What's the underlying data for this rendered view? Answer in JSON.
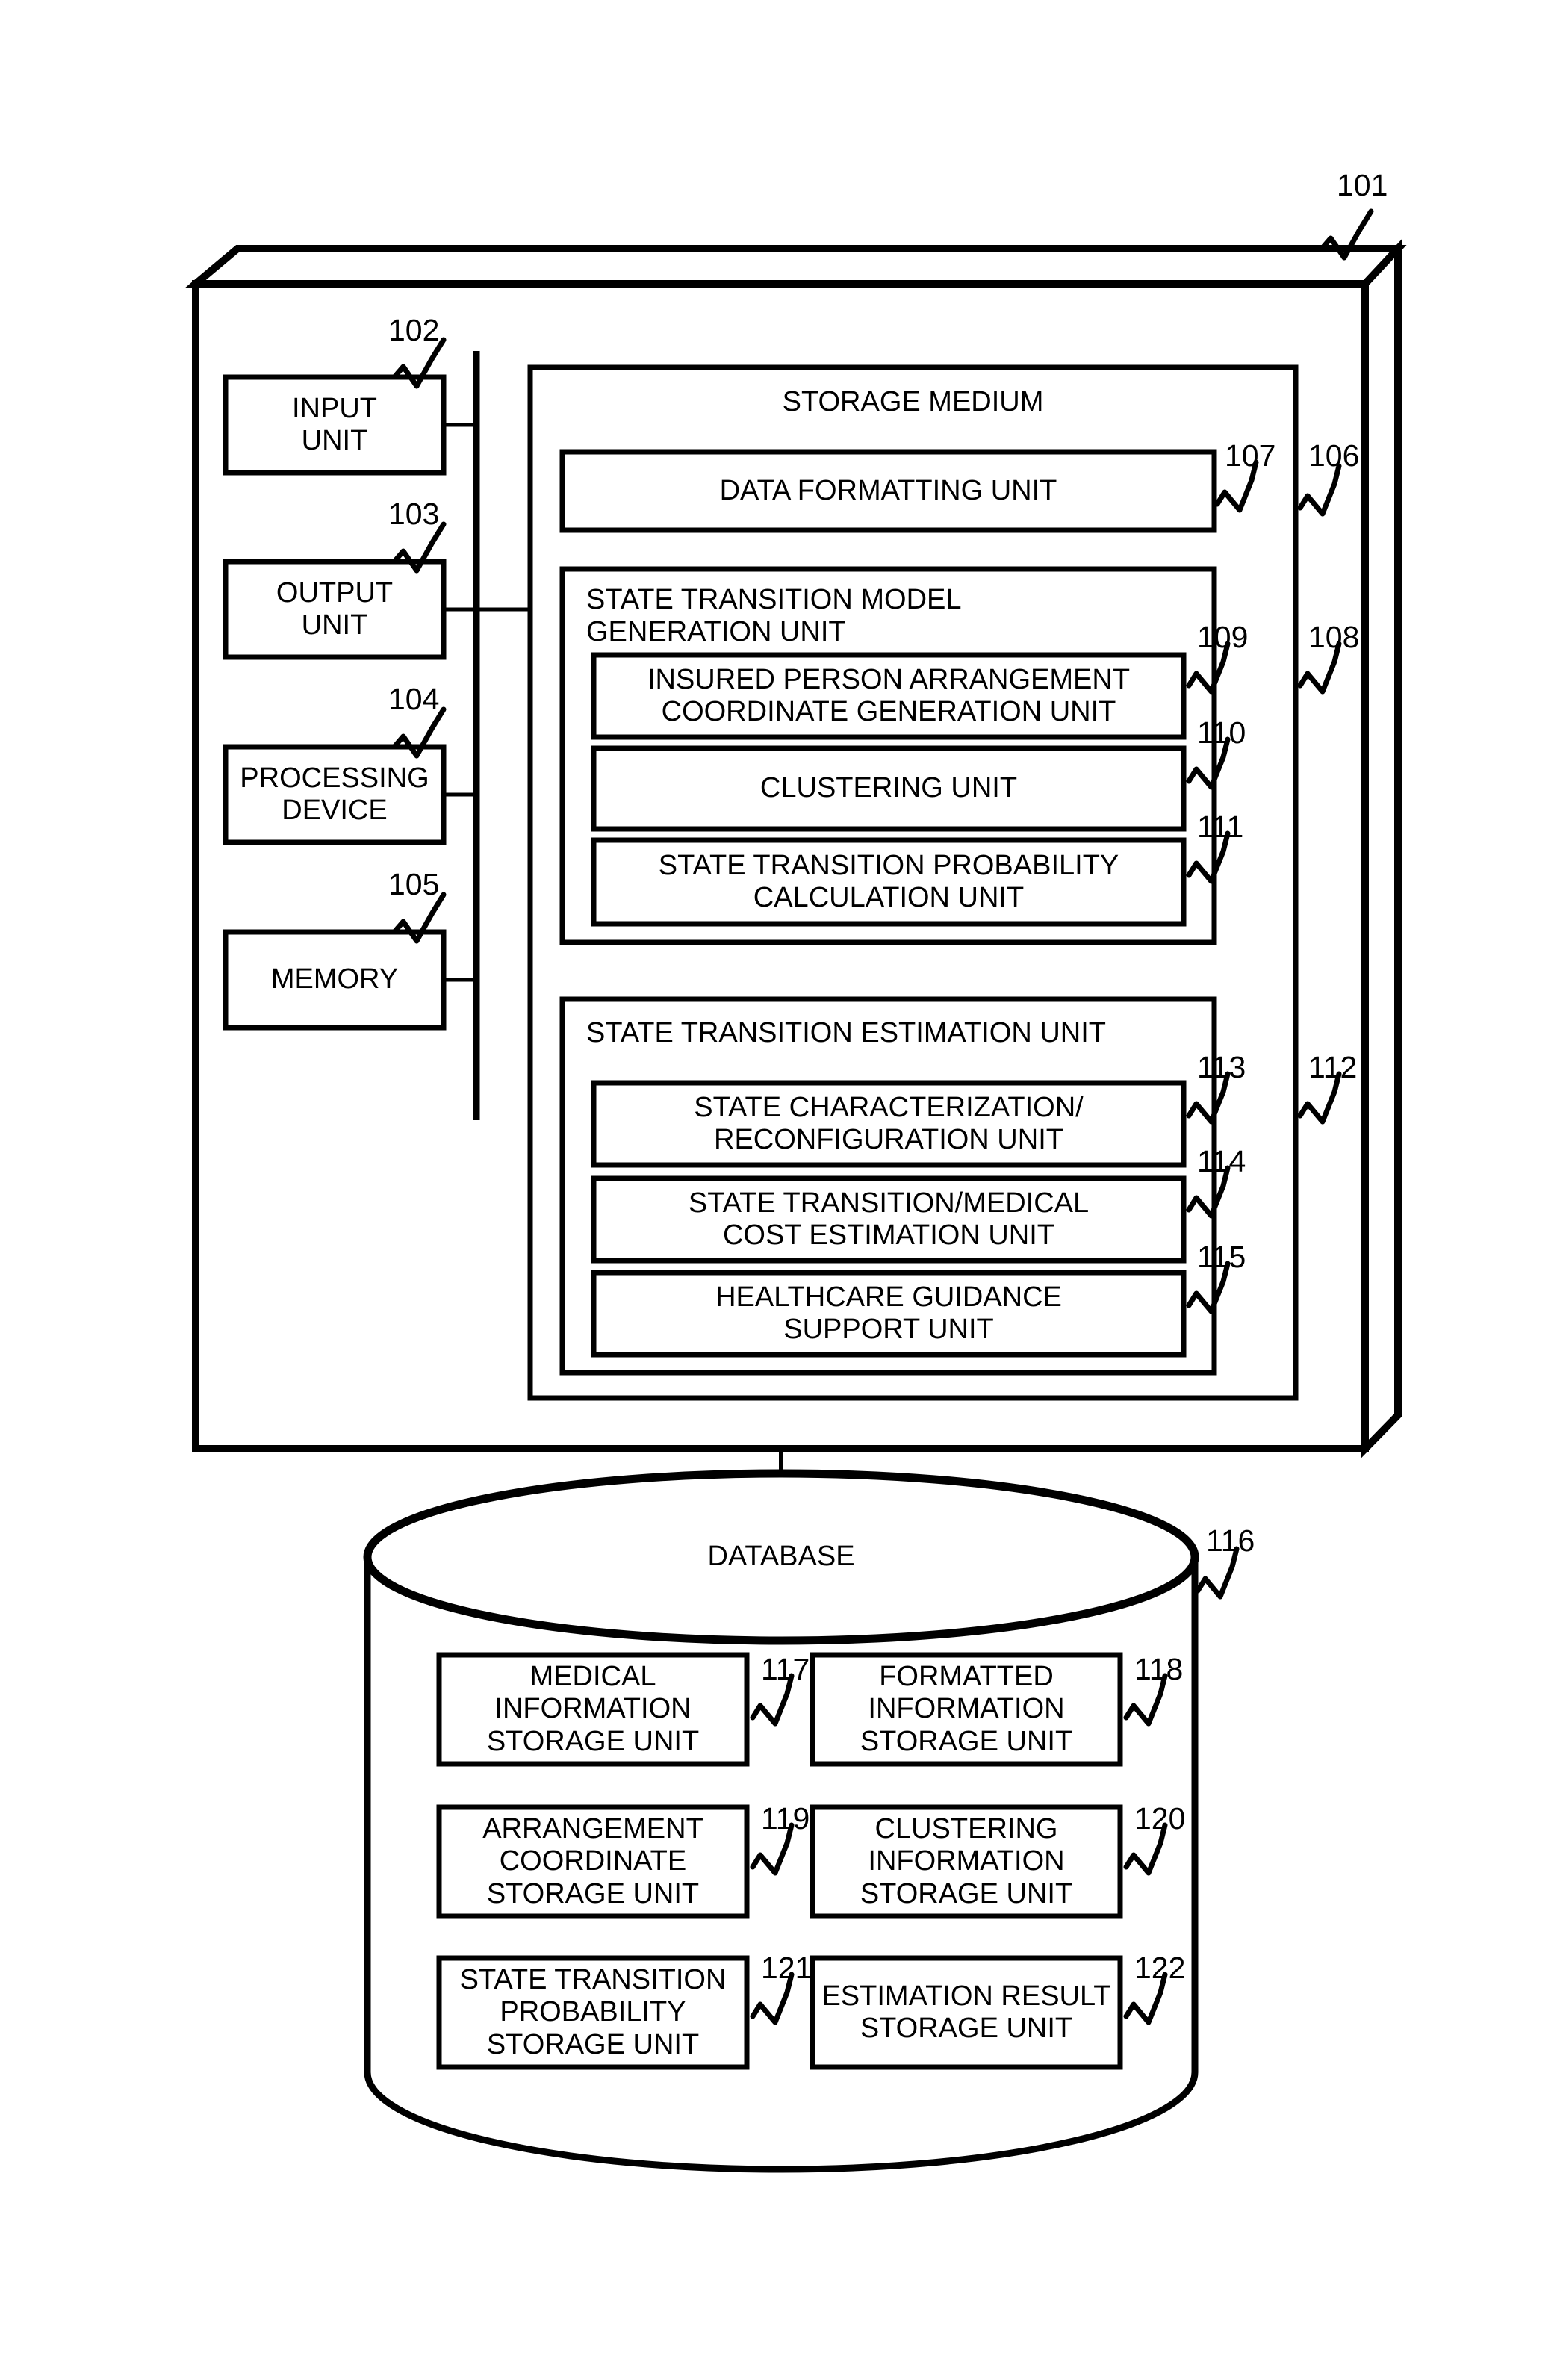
{
  "figure": {
    "type": "patent-block-diagram",
    "system_ref": "101",
    "device_boxes": [
      {
        "ref": "102",
        "label": "INPUT\nUNIT"
      },
      {
        "ref": "103",
        "label": "OUTPUT\nUNIT"
      },
      {
        "ref": "104",
        "label": "PROCESSING\nDEVICE"
      },
      {
        "ref": "105",
        "label": "MEMORY"
      }
    ],
    "storage_medium": {
      "ref": "106",
      "title": "STORAGE MEDIUM",
      "data_formatting_unit": {
        "ref": "107",
        "label": "DATA FORMATTING UNIT"
      },
      "model_generation_unit": {
        "ref": "108",
        "title": "STATE TRANSITION MODEL\nGENERATION UNIT",
        "children": [
          {
            "ref": "109",
            "label": "INSURED PERSON ARRANGEMENT\nCOORDINATE GENERATION UNIT"
          },
          {
            "ref": "110",
            "label": "CLUSTERING UNIT"
          },
          {
            "ref": "111",
            "label": "STATE TRANSITION PROBABILITY\nCALCULATION UNIT"
          }
        ]
      },
      "estimation_unit": {
        "ref": "112",
        "title": "STATE TRANSITION ESTIMATION UNIT",
        "children": [
          {
            "ref": "113",
            "label": "STATE CHARACTERIZATION/\nRECONFIGURATION UNIT"
          },
          {
            "ref": "114",
            "label": "STATE TRANSITION/MEDICAL\nCOST ESTIMATION UNIT"
          },
          {
            "ref": "115",
            "label": "HEALTHCARE GUIDANCE\nSUPPORT UNIT"
          }
        ]
      }
    },
    "database": {
      "ref": "116",
      "title": "DATABASE",
      "storage_units": [
        {
          "ref": "117",
          "label": "MEDICAL\nINFORMATION\nSTORAGE UNIT"
        },
        {
          "ref": "118",
          "label": "FORMATTED\nINFORMATION\nSTORAGE UNIT"
        },
        {
          "ref": "119",
          "label": "ARRANGEMENT\nCOORDINATE\nSTORAGE UNIT"
        },
        {
          "ref": "120",
          "label": "CLUSTERING\nINFORMATION\nSTORAGE UNIT"
        },
        {
          "ref": "121",
          "label": "STATE TRANSITION\nPROBABILITY\nSTORAGE UNIT"
        },
        {
          "ref": "122",
          "label": "ESTIMATION RESULT\nSTORAGE UNIT"
        }
      ]
    },
    "colors": {
      "ink": "#000000",
      "paper": "#ffffff"
    }
  }
}
